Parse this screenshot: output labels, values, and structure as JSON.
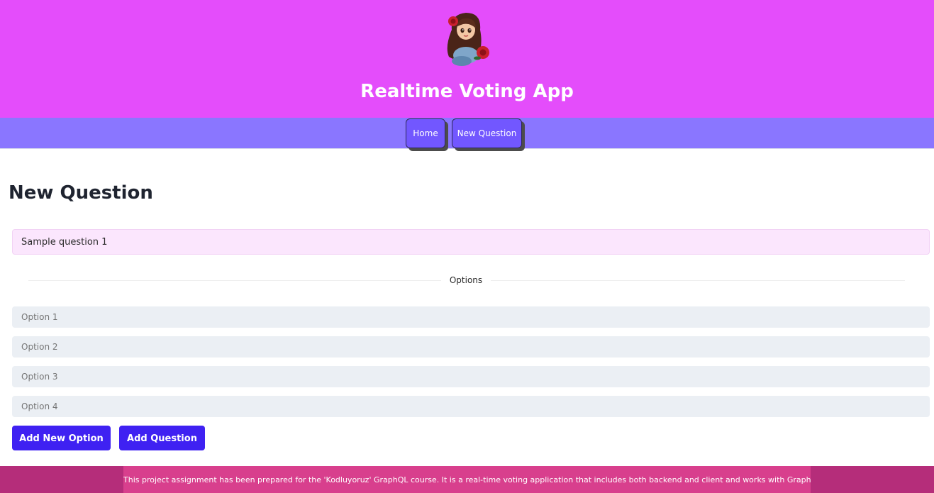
{
  "header": {
    "avatar_icon": "girl-with-roses-avatar-icon",
    "title": "Realtime Voting App",
    "background": "#e44dfb"
  },
  "nav": {
    "background": "#8a76ff",
    "button_color": "#7257ff",
    "items": [
      {
        "label": "Home"
      },
      {
        "label": "New Question"
      }
    ]
  },
  "main": {
    "page_title": "New Question",
    "question_value": "Sample question 1",
    "options_divider_label": "Options",
    "options": [
      {
        "placeholder": "Option 1"
      },
      {
        "placeholder": "Option 2"
      },
      {
        "placeholder": "Option 3"
      },
      {
        "placeholder": "Option 4"
      }
    ],
    "add_option_label": "Add New Option",
    "add_question_label": "Add Question",
    "button_color": "#3f21f2"
  },
  "footer": {
    "text": "This project assignment has been prepared for the 'Kodluyoruz' GraphQL course. It is a real-time voting application that includes both backend and client and works with GraphQL.",
    "background": "#b52d7a"
  }
}
